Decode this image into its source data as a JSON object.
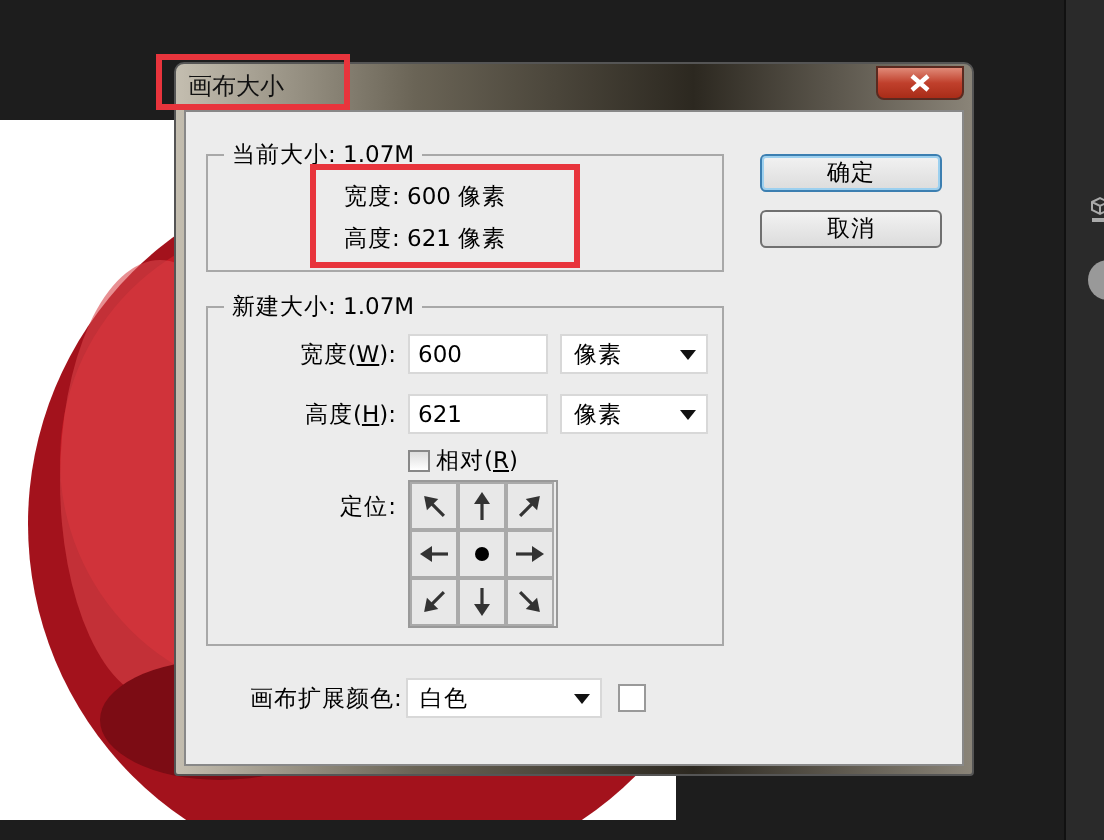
{
  "window": {
    "title": "画布大小"
  },
  "current_size": {
    "legend": "当前大小: 1.07M",
    "lines": [
      {
        "label": "宽度:",
        "value": "600",
        "unit": "像素"
      },
      {
        "label": "高度:",
        "value": "621",
        "unit": "像素"
      }
    ]
  },
  "new_size": {
    "legend": "新建大小: 1.07M",
    "fields": [
      {
        "label_before": "宽度(",
        "accesskey": "W",
        "label_after": "):",
        "value": "600",
        "unit": "像素"
      },
      {
        "label_before": "高度(",
        "accesskey": "H",
        "label_after": "):",
        "value": "621",
        "unit": "像素"
      }
    ],
    "relative": {
      "label_before": "相对(",
      "accesskey": "R",
      "label_after": ")",
      "checked": false
    },
    "anchor": {
      "label": "定位:",
      "cells": [
        {
          "selected": false
        },
        {
          "selected": false
        },
        {
          "selected": false
        },
        {
          "selected": false
        },
        {
          "selected": true
        },
        {
          "selected": false
        },
        {
          "selected": false
        },
        {
          "selected": false
        },
        {
          "selected": false
        }
      ]
    }
  },
  "extension_color": {
    "label": "画布扩展颜色:",
    "value": "白色",
    "color": "#ffffff"
  },
  "buttons": [
    {
      "label": "确定",
      "default": true
    },
    {
      "label": "取消",
      "default": false
    }
  ]
}
